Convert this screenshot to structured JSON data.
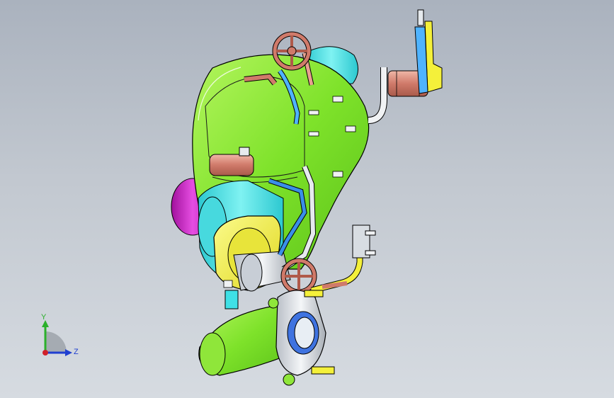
{
  "viewport": {
    "background": "#c2c8d0",
    "model_colors": {
      "housing_green": "#7ee22a",
      "housing_light": "#a9ef52",
      "cyan_part": "#3fe0e6",
      "magenta_part": "#d21fd0",
      "yellow_part": "#f4f03a",
      "copper_part": "#d07a6a",
      "blue_pipe": "#3a8fe8",
      "silver_part": "#d8dde2",
      "bearing_blue": "#3f73e0"
    }
  },
  "triad": {
    "y_label": "Y",
    "z_label": "Z",
    "y_color": "#2bb02b",
    "z_color": "#1f3fd0",
    "x_color": "#d0202a"
  }
}
